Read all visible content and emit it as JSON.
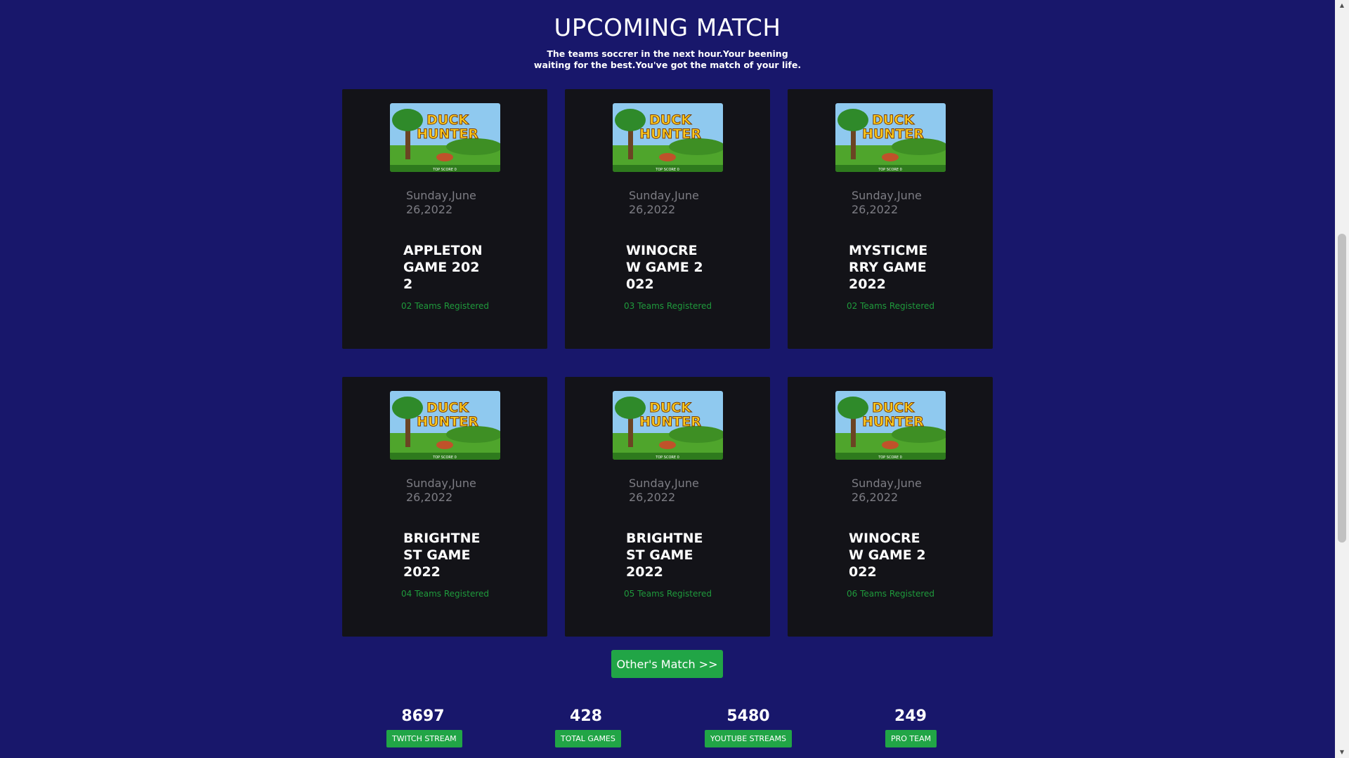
{
  "header": {
    "title": "UPCOMING MATCH",
    "subtitle": "The teams soccrer in the next hour.Your beening waiting for the best.You've got the match of your life."
  },
  "game_image": {
    "logo_top": "DUCK",
    "logo_bottom": "HUNTER",
    "score_text": "TOP SCORE 0"
  },
  "matches": [
    {
      "date": "Sunday,June 26,2022",
      "title": "APPLETON GAME 2022",
      "teams": "02 Teams Registered"
    },
    {
      "date": "Sunday,June 26,2022",
      "title": "WINOCREW GAME 2022",
      "teams": "03 Teams Registered"
    },
    {
      "date": "Sunday,June 26,2022",
      "title": "MYSTICMERRY GAME 2022",
      "teams": "02 Teams Registered"
    },
    {
      "date": "Sunday,June 26,2022",
      "title": "BRIGHTNEST GAME 2022",
      "teams": "04 Teams Registered"
    },
    {
      "date": "Sunday,June 26,2022",
      "title": "BRIGHTNEST GAME 2022",
      "teams": "05 Teams Registered"
    },
    {
      "date": "Sunday,June 26,2022",
      "title": "WINOCREW GAME 2022",
      "teams": "06 Teams Registered"
    }
  ],
  "other_button": "Other's Match >>",
  "stats": [
    {
      "value": "8697",
      "label": "TWITCH STREAM"
    },
    {
      "value": "428",
      "label": "TOTAL GAMES"
    },
    {
      "value": "5480",
      "label": "YOUTUBE STREAMS"
    },
    {
      "value": "249",
      "label": "PRO TEAM"
    }
  ],
  "colors": {
    "background": "#18176b",
    "card": "#131318",
    "accent_green": "#21a546",
    "teams_text": "#1f9a3c",
    "date_text": "#7d7d84"
  }
}
